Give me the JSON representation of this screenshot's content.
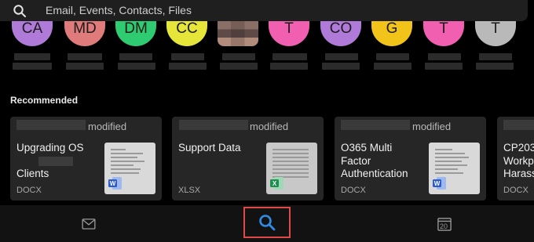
{
  "search": {
    "placeholder": "Email, Events, Contacts, Files",
    "icon": "search-icon"
  },
  "avatars": [
    {
      "initials": "CA",
      "color": "#b07ad8"
    },
    {
      "initials": "MD",
      "color": "#e07b7b"
    },
    {
      "initials": "DM",
      "color": "#2ecb71"
    },
    {
      "initials": "CC",
      "color": "#e5e53a"
    },
    {
      "initials": "",
      "color": "#7a5f58",
      "photo": true
    },
    {
      "initials": "T",
      "color": "#f15fb0"
    },
    {
      "initials": "CO",
      "color": "#b07ad8"
    },
    {
      "initials": "G",
      "color": "#f2c318"
    },
    {
      "initials": "T",
      "color": "#f15fb0"
    },
    {
      "initials": "T",
      "color": "#b9b9b9"
    }
  ],
  "recommended": {
    "title": "Recommended",
    "files": [
      {
        "status": "modified",
        "name_line1": "Upgrading OS",
        "name_line2": "Clients",
        "type": "DOCX",
        "app_icon": "word-icon"
      },
      {
        "status": "modified",
        "name_line1": "Support Data",
        "name_line2": "",
        "type": "XLSX",
        "app_icon": "excel-icon"
      },
      {
        "status": "modified",
        "name_line1": "O365 Multi",
        "name_line2": "Factor",
        "name_line3": "Authentication",
        "type": "DOCX",
        "app_icon": "word-icon"
      },
      {
        "status": "",
        "name_line1": "CP203",
        "name_line2": "Workp",
        "name_line3": "Harass",
        "type": "DOCX",
        "app_icon": "word-icon"
      }
    ]
  },
  "bottom_nav": {
    "mail_icon": "mail-icon",
    "search_icon": "search-icon",
    "calendar_icon": "calendar-icon",
    "calendar_day": "20",
    "accent": "#2f8ce6",
    "highlight": "#e04848"
  }
}
